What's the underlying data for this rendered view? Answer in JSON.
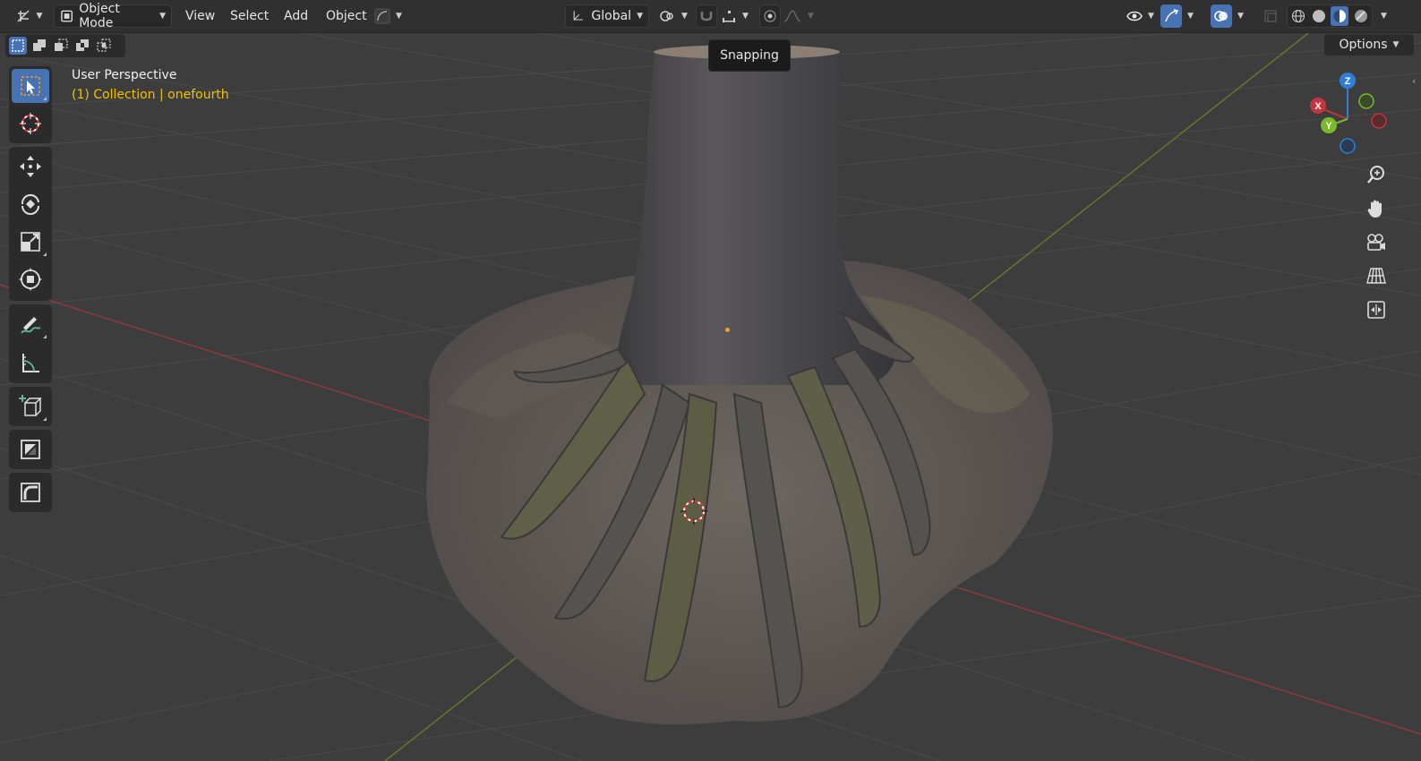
{
  "header": {
    "editor_type_icon": "3d-viewport-icon",
    "mode": "Object Mode",
    "menus": [
      "View",
      "Select",
      "Add",
      "Object"
    ],
    "transform_orientation": "Global"
  },
  "viewport": {
    "perspective": "User Perspective",
    "collection": "(1) Collection | onefourth"
  },
  "tooltip": {
    "text": "Snapping"
  },
  "options_label": "Options",
  "gizmo": {
    "x": "X",
    "y": "Y",
    "z": "Z"
  },
  "toolbar": {
    "tools": [
      "select-box",
      "cursor",
      "move",
      "rotate",
      "scale",
      "transform",
      "annotate",
      "measure",
      "add-cube",
      "extrude",
      "bevel"
    ],
    "active_tool": "select-box"
  },
  "viewport_shading": "material-preview",
  "colors": {
    "accent": "#4772b3",
    "x_axis": "#c0373f",
    "y_axis": "#79b92a",
    "z_axis": "#2f7fd8",
    "collection_text": "#f0c000"
  }
}
